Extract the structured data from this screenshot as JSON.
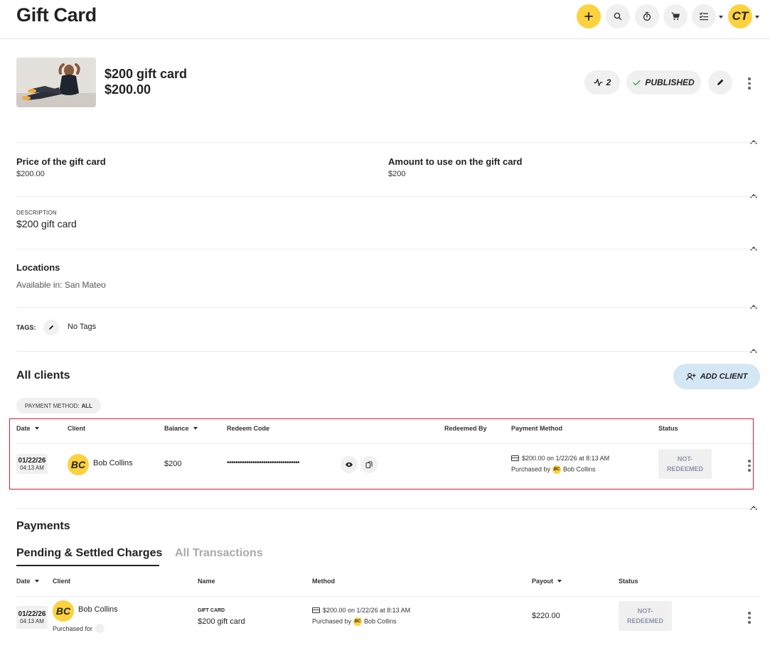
{
  "header": {
    "title": "Gift Card",
    "avatar_initials": "CT"
  },
  "product": {
    "name": "$200 gift card",
    "price": "$200.00",
    "activity_count": "2",
    "status": "PUBLISHED"
  },
  "details": {
    "price_label": "Price of the gift card",
    "price_value": "$200.00",
    "amount_label": "Amount to use on the gift card",
    "amount_value": "$200",
    "description_label": "DESCRIPTION",
    "description_value": "$200 gift card",
    "locations_label": "Locations",
    "locations_value": "Available in: San Mateo",
    "tags_label": "TAGS:",
    "tags_value": "No Tags"
  },
  "clients": {
    "title": "All clients",
    "add_button": "ADD CLIENT",
    "filter_label": "PAYMENT METHOD:",
    "filter_value": "ALL",
    "columns": {
      "date": "Date",
      "client": "Client",
      "balance": "Balance",
      "redeem_code": "Redeem Code",
      "redeemed_by": "Redeemed By",
      "payment_method": "Payment Method",
      "status": "Status"
    },
    "rows": [
      {
        "date": "01/22/26",
        "time": "04:13 AM",
        "initials": "BC",
        "client": "Bob Collins",
        "balance": "$200",
        "redeem_code": "••••••••••••••••••••••••••••••••••",
        "payment_line": "$200.00 on 1/22/26 at 8:13 AM",
        "purchased_by_label": "Purchased by",
        "purchased_by_initials": "BC",
        "purchased_by_name": "Bob Collins",
        "status_line1": "NOT-",
        "status_line2": "REDEEMED"
      }
    ]
  },
  "payments": {
    "title": "Payments",
    "tabs": [
      {
        "label": "Pending & Settled Charges",
        "active": true
      },
      {
        "label": "All Transactions",
        "active": false
      }
    ],
    "columns": {
      "date": "Date",
      "client": "Client",
      "name": "Name",
      "method": "Method",
      "payout": "Payout",
      "status": "Status"
    },
    "rows": [
      {
        "date": "01/22/26",
        "time": "04:13 AM",
        "initials": "BC",
        "client": "Bob Collins",
        "purchased_for_label": "Purchased for",
        "name_label": "GIFT CARD",
        "name": "$200 gift card",
        "method_line": "$200.00 on 1/22/26 at 8:13 AM",
        "purchased_by_label": "Purchased by",
        "purchased_by_initials": "BC",
        "purchased_by_name": "Bob Collins",
        "payout": "$220.00",
        "status_line1": "NOT-",
        "status_line2": "REDEEMED"
      }
    ]
  },
  "colors": {
    "accent_yellow": "#fdd23e",
    "add_client_bg": "#d5e6f5",
    "status_text": "#8b93a8",
    "highlight_border": "#d0202a"
  }
}
